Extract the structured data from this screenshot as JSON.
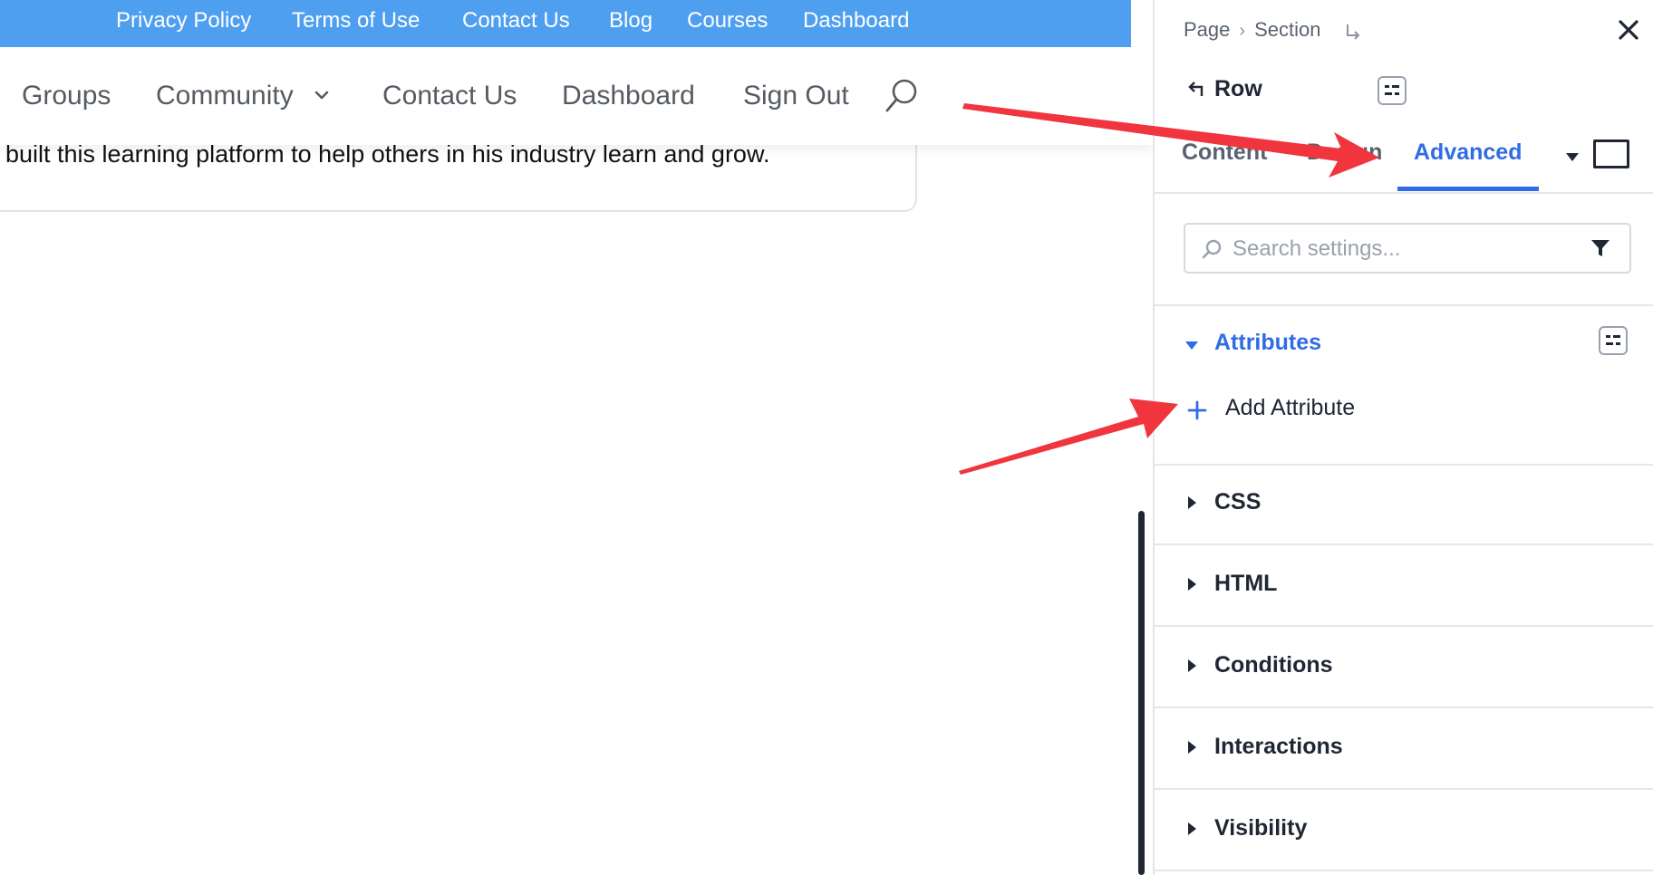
{
  "topbar": {
    "links": [
      "Privacy Policy",
      "Terms of Use",
      "Contact Us",
      "Blog",
      "Courses",
      "Dashboard"
    ]
  },
  "mainnav": {
    "groups": "Groups",
    "community": "Community",
    "contact": "Contact Us",
    "dashboard": "Dashboard",
    "signout": "Sign Out"
  },
  "card": {
    "text": "built this learning platform to help others in his industry learn and grow."
  },
  "panel": {
    "breadcrumb": {
      "page": "Page",
      "section": "Section"
    },
    "element": "Row",
    "tabs": {
      "content": "Content",
      "design": "Design",
      "advanced": "Advanced"
    },
    "search": {
      "placeholder": "Search settings..."
    },
    "attributes": {
      "title": "Attributes",
      "add_label": "Add Attribute"
    },
    "sections": [
      "CSS",
      "HTML",
      "Conditions",
      "Interactions",
      "Visibility"
    ]
  },
  "colors": {
    "accent": "#2f6ce5",
    "topbar": "#4f9ff0",
    "annotation": "#f0353f"
  },
  "icons": [
    "search-icon",
    "chevron-down-icon",
    "close-icon",
    "back-arrow-icon",
    "filter-icon",
    "plus-icon",
    "caret-down-icon",
    "caret-right-icon",
    "responsive-device-icon"
  ]
}
